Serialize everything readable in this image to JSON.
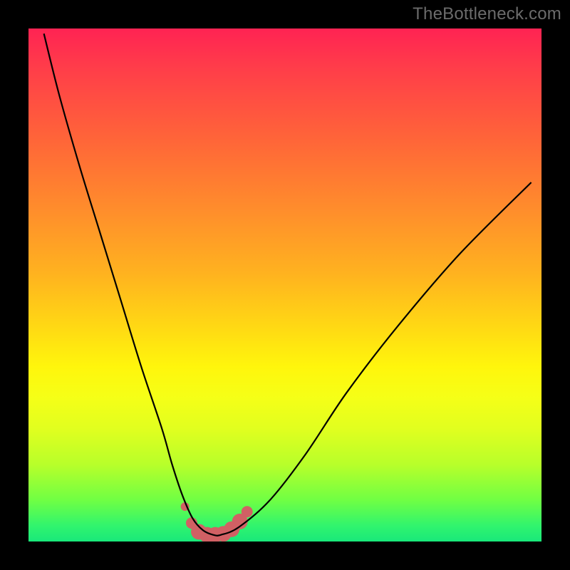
{
  "watermark": "TheBottleneck.com",
  "colors": {
    "page_bg": "#000000",
    "watermark": "#6b6b6b",
    "curve_stroke": "#000000",
    "marker": "#d16064",
    "gradient_top": "#ff2353",
    "gradient_bottom": "#19e87a"
  },
  "chart_data": {
    "type": "line",
    "title": "",
    "xlabel": "",
    "ylabel": "",
    "xlim": [
      0,
      100
    ],
    "ylim": [
      0,
      100
    ],
    "grid": false,
    "legend_position": "none",
    "series": [
      {
        "name": "bottleneck-curve",
        "x": [
          3,
          6,
          10,
          14,
          18,
          22,
          26,
          28,
          30,
          32,
          34,
          36,
          37.5,
          41,
          47,
          54,
          62,
          72,
          84,
          98
        ],
        "values": [
          99,
          87,
          73,
          60,
          47,
          34,
          22,
          15,
          9,
          4.5,
          2.2,
          1.3,
          1.3,
          2.8,
          8,
          17,
          29,
          42,
          56,
          70
        ]
      }
    ],
    "markers": [
      {
        "x": 30.5,
        "y": 6.8
      },
      {
        "x": 31.8,
        "y": 3.6
      },
      {
        "x": 33.2,
        "y": 1.9
      },
      {
        "x": 34.8,
        "y": 1.3
      },
      {
        "x": 36.4,
        "y": 1.3
      },
      {
        "x": 38.0,
        "y": 1.5
      },
      {
        "x": 39.6,
        "y": 2.4
      },
      {
        "x": 41.2,
        "y": 3.9
      },
      {
        "x": 42.6,
        "y": 5.8
      }
    ],
    "annotations": []
  }
}
